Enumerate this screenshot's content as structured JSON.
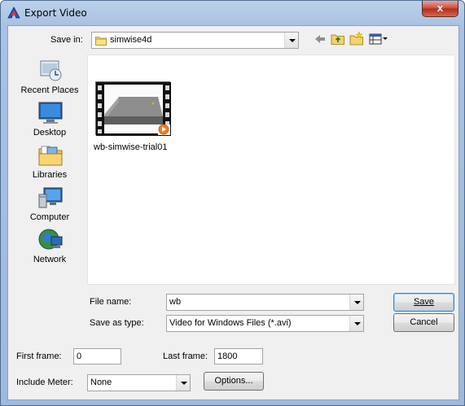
{
  "window": {
    "title": "Export Video",
    "close_glyph": "x"
  },
  "save_in": {
    "label": "Save in:",
    "value": "simwise4d"
  },
  "places": [
    {
      "label": "Recent Places",
      "icon": "recent-places-icon"
    },
    {
      "label": "Desktop",
      "icon": "desktop-icon"
    },
    {
      "label": "Libraries",
      "icon": "libraries-icon"
    },
    {
      "label": "Computer",
      "icon": "computer-icon"
    },
    {
      "label": "Network",
      "icon": "network-icon"
    }
  ],
  "files": [
    {
      "name": "wb-simwise-trial01",
      "icon": "video-thumbnail-icon"
    }
  ],
  "file_name": {
    "label": "File name:",
    "value": "wb"
  },
  "save_as_type": {
    "label": "Save as type:",
    "value": "Video for Windows Files (*.avi)"
  },
  "buttons": {
    "save": "Save",
    "cancel": "Cancel",
    "options": "Options..."
  },
  "first_frame": {
    "label": "First frame:",
    "value": "0"
  },
  "last_frame": {
    "label": "Last frame:",
    "value": "1800"
  },
  "include_meter": {
    "label": "Include Meter:",
    "value": "None"
  },
  "colors": {
    "titlebar": "#a9c2e2",
    "close_button": "#c9493b",
    "dialog_bg": "#f0f0f0"
  }
}
